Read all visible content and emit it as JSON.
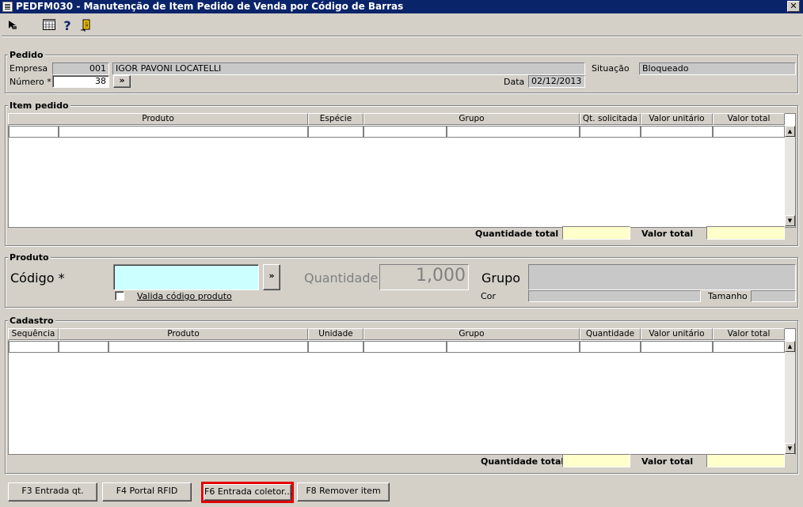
{
  "window": {
    "title": "PEDFM030 - Manutenção de Item Pedido de Venda por Código de Barras",
    "close_label": "✕"
  },
  "toolbar": {
    "icons": [
      "cursor-arrow-icon",
      "calendar-grid-icon",
      "help-icon",
      "exit-door-icon"
    ],
    "help_glyph": "?"
  },
  "pedido": {
    "group_label": "Pedido",
    "empresa_label": "Empresa",
    "empresa_code": "001",
    "empresa_name": "IGOR PAVONI LOCATELLI",
    "situacao_label": "Situação",
    "situacao_value": "Bloqueado",
    "numero_label": "Número *",
    "numero_value": "38",
    "lookup_label": "»",
    "data_label": "Data",
    "data_value": "02/12/2013"
  },
  "item_pedido": {
    "group_label": "Item pedido",
    "columns": [
      "Produto",
      "Espécie",
      "Grupo",
      "Qt. solicitada",
      "Valor unitário",
      "Valor total"
    ],
    "quantidade_total_label": "Quantidade total",
    "quantidade_total_value": "",
    "valor_total_label": "Valor total",
    "valor_total_value": ""
  },
  "produto": {
    "group_label": "Produto",
    "codigo_label": "Código *",
    "codigo_value": "",
    "lookup_label": "»",
    "quantidade_label": "Quantidade",
    "quantidade_value": "1,000",
    "grupo_label": "Grupo",
    "grupo_value": "",
    "valida_label": "Valida código produto",
    "valida_checked": false,
    "cor_label": "Cor",
    "cor_value": "",
    "tamanho_label": "Tamanho",
    "tamanho_value": ""
  },
  "cadastro": {
    "group_label": "Cadastro",
    "columns": [
      "Sequência",
      "Produto",
      "Unidade",
      "Grupo",
      "Quantidade",
      "Valor unitário",
      "Valor total"
    ],
    "quantidade_total_label": "Quantidade total",
    "quantidade_total_value": "",
    "valor_total_label": "Valor total",
    "valor_total_value": ""
  },
  "footer_buttons": {
    "f3": "F3 Entrada qt.",
    "f4": "F4 Portal RFID",
    "f6": "F6 Entrada coletor...",
    "f8": "F8 Remover item"
  },
  "colors": {
    "window_bg": "#d4d0c8",
    "titlebar_bg": "#0a246a",
    "input_cyan": "#ccffff",
    "total_yellow": "#ffffcc",
    "highlight_red": "#e00000"
  }
}
